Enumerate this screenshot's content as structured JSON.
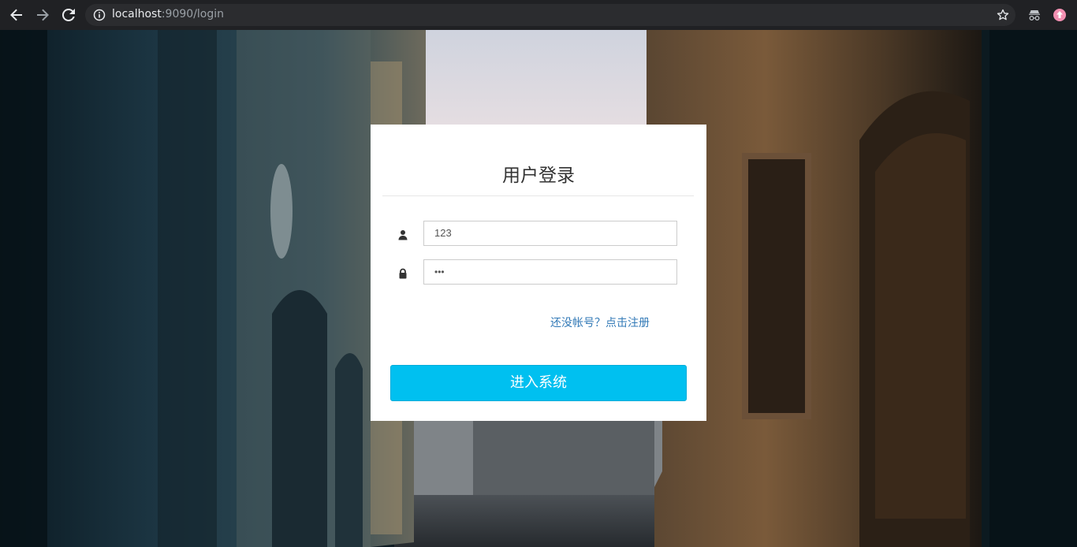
{
  "browser": {
    "url_host": "localhost",
    "url_path": ":9090/login",
    "icons": [
      "back-arrow-icon",
      "forward-arrow-icon",
      "reload-icon",
      "info-icon",
      "star-icon",
      "incognito-icon",
      "profile-icon"
    ]
  },
  "login": {
    "title": "用户登录",
    "username_value": "123",
    "password_value": "•••",
    "register_link": "还没帐号？点击注册",
    "submit_label": "进入系统",
    "accent_color": "#00c0f0",
    "link_color": "#337ab7"
  }
}
